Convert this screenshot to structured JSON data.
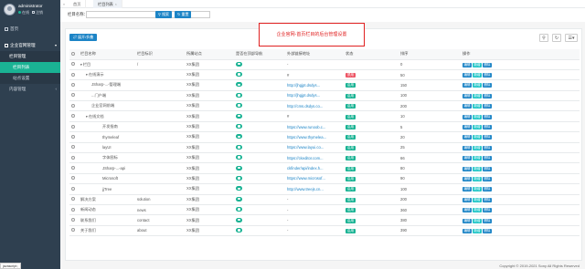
{
  "sidebar": {
    "user": {
      "name": "administrator",
      "status": "在线",
      "logout": "注销"
    },
    "home": "首页",
    "group": "企业官网管理",
    "submenu_parent": "栏目管理",
    "items": [
      {
        "label": "栏目列表",
        "active": true
      },
      {
        "label": "站点设置",
        "active": false
      }
    ],
    "other": "内容管理"
  },
  "status_corner": "javascript:;",
  "tabs": [
    {
      "label": "首页",
      "active": false
    },
    {
      "label": "栏目列表",
      "active": true
    }
  ],
  "search": {
    "label": "栏目名称：",
    "value": "",
    "search_btn": "搜索",
    "reset_btn": "重置"
  },
  "toolbar": {
    "expand": "展开/折叠"
  },
  "table": {
    "columns": [
      "",
      "栏目名称",
      "栏目标识",
      "所属站点",
      "是否在顶部导航",
      "外部链接地址",
      "状态",
      "排序",
      "操作"
    ],
    "rows": [
      {
        "indent": 0,
        "toggle": "v",
        "name": "栏目",
        "key": "/",
        "site": "XX集团",
        "link": "-",
        "status": "",
        "order": "0",
        "actions": [
          "编辑",
          "新增",
          "删除"
        ]
      },
      {
        "indent": 1,
        "toggle": "v",
        "name": "在线演示",
        "key": "",
        "site": "XX集团",
        "link": "#",
        "status": "禁用",
        "order": "50",
        "actions": [
          "编辑",
          "新增",
          "删除"
        ]
      },
      {
        "indent": 2,
        "toggle": "",
        "name": "JSharp-...-管理端",
        "key": "",
        "site": "XX集团",
        "link": "http://jhgjpt.dsdys...",
        "status": "启用",
        "order": "150",
        "actions": [
          "编辑",
          "新增",
          "删除"
        ]
      },
      {
        "indent": 2,
        "toggle": "",
        "name": "...门户端",
        "key": "",
        "site": "XX集团",
        "link": "http://jhgjpt.dsdys...",
        "status": "启用",
        "order": "100",
        "actions": [
          "编辑",
          "新增",
          "删除"
        ]
      },
      {
        "indent": 2,
        "toggle": "",
        "name": "企业官网前端",
        "key": "",
        "site": "XX集团",
        "link": "http://cms.dsdys.co...",
        "status": "启用",
        "order": "200",
        "actions": [
          "编辑",
          "新增",
          "删除"
        ]
      },
      {
        "indent": 1,
        "toggle": "v",
        "name": "在线文档",
        "key": "",
        "site": "XX集团",
        "link": "#",
        "status": "启用",
        "order": "10",
        "actions": [
          "编辑",
          "新增",
          "删除"
        ]
      },
      {
        "indent": 3,
        "toggle": "",
        "name": "开发指南",
        "key": "",
        "site": "XX集团",
        "link": "https://www.runoob.c...",
        "status": "启用",
        "order": "5",
        "actions": [
          "编辑",
          "新增",
          "删除"
        ]
      },
      {
        "indent": 3,
        "toggle": "",
        "name": "thymeleaf",
        "key": "",
        "site": "XX集团",
        "link": "https://www.thymelea...",
        "status": "启用",
        "order": "20",
        "actions": [
          "编辑",
          "新增",
          "删除"
        ]
      },
      {
        "indent": 3,
        "toggle": "",
        "name": "layUI",
        "key": "",
        "site": "XX集团",
        "link": "https://www.layui.co...",
        "status": "启用",
        "order": "25",
        "actions": [
          "编辑",
          "新增",
          "删除"
        ]
      },
      {
        "indent": 3,
        "toggle": "",
        "name": "字体图标",
        "key": "",
        "site": "XX集团",
        "link": "https://ckeditor.com...",
        "status": "启用",
        "order": "66",
        "actions": [
          "编辑",
          "新增",
          "删除"
        ]
      },
      {
        "indent": 3,
        "toggle": "",
        "name": "JSharp-...-api",
        "key": "",
        "site": "XX集团",
        "link": "ckfinder/api/index.h...",
        "status": "启用",
        "order": "80",
        "actions": [
          "编辑",
          "新增",
          "删除"
        ]
      },
      {
        "indent": 3,
        "toggle": "",
        "name": "Microsoft",
        "key": "",
        "site": "XX集团",
        "link": "https://www.microsof...",
        "status": "启用",
        "order": "90",
        "actions": [
          "编辑",
          "新增",
          "删除"
        ]
      },
      {
        "indent": 3,
        "toggle": "",
        "name": "jjTree",
        "key": "",
        "site": "XX集团",
        "link": "http://www.treejs.cn...",
        "status": "启用",
        "order": "100",
        "actions": [
          "编辑",
          "新增",
          "删除"
        ]
      },
      {
        "indent": 0,
        "toggle": "",
        "name": "解决方案",
        "key": "solution",
        "site": "XX集团",
        "link": "-",
        "status": "启用",
        "order": "200",
        "actions": [
          "编辑",
          "新增",
          "删除"
        ]
      },
      {
        "indent": 0,
        "toggle": "",
        "name": "新闻动态",
        "key": "news",
        "site": "XX集团",
        "link": "-",
        "status": "启用",
        "order": "360",
        "actions": [
          "编辑",
          "新增",
          "删除"
        ]
      },
      {
        "indent": 0,
        "toggle": "",
        "name": "联系我们",
        "key": "contact",
        "site": "XX集团",
        "link": "-",
        "status": "启用",
        "order": "380",
        "actions": [
          "编辑",
          "新增",
          "删除"
        ]
      },
      {
        "indent": 0,
        "toggle": "",
        "name": "关于我们",
        "key": "about",
        "site": "XX集团",
        "link": "-",
        "status": "启用",
        "order": "390",
        "actions": [
          "编辑",
          "新增",
          "删除"
        ]
      }
    ]
  },
  "footer": "Copyright © 2019-2021 Sony All Rights Reserved",
  "note": "企业官网-首页栏目的后台管理设置",
  "colors": {
    "sidebar": "#2f4050",
    "accent": "#1ab394",
    "primary": "#1c84c6",
    "danger": "#ed5565",
    "note": "#e02020"
  }
}
